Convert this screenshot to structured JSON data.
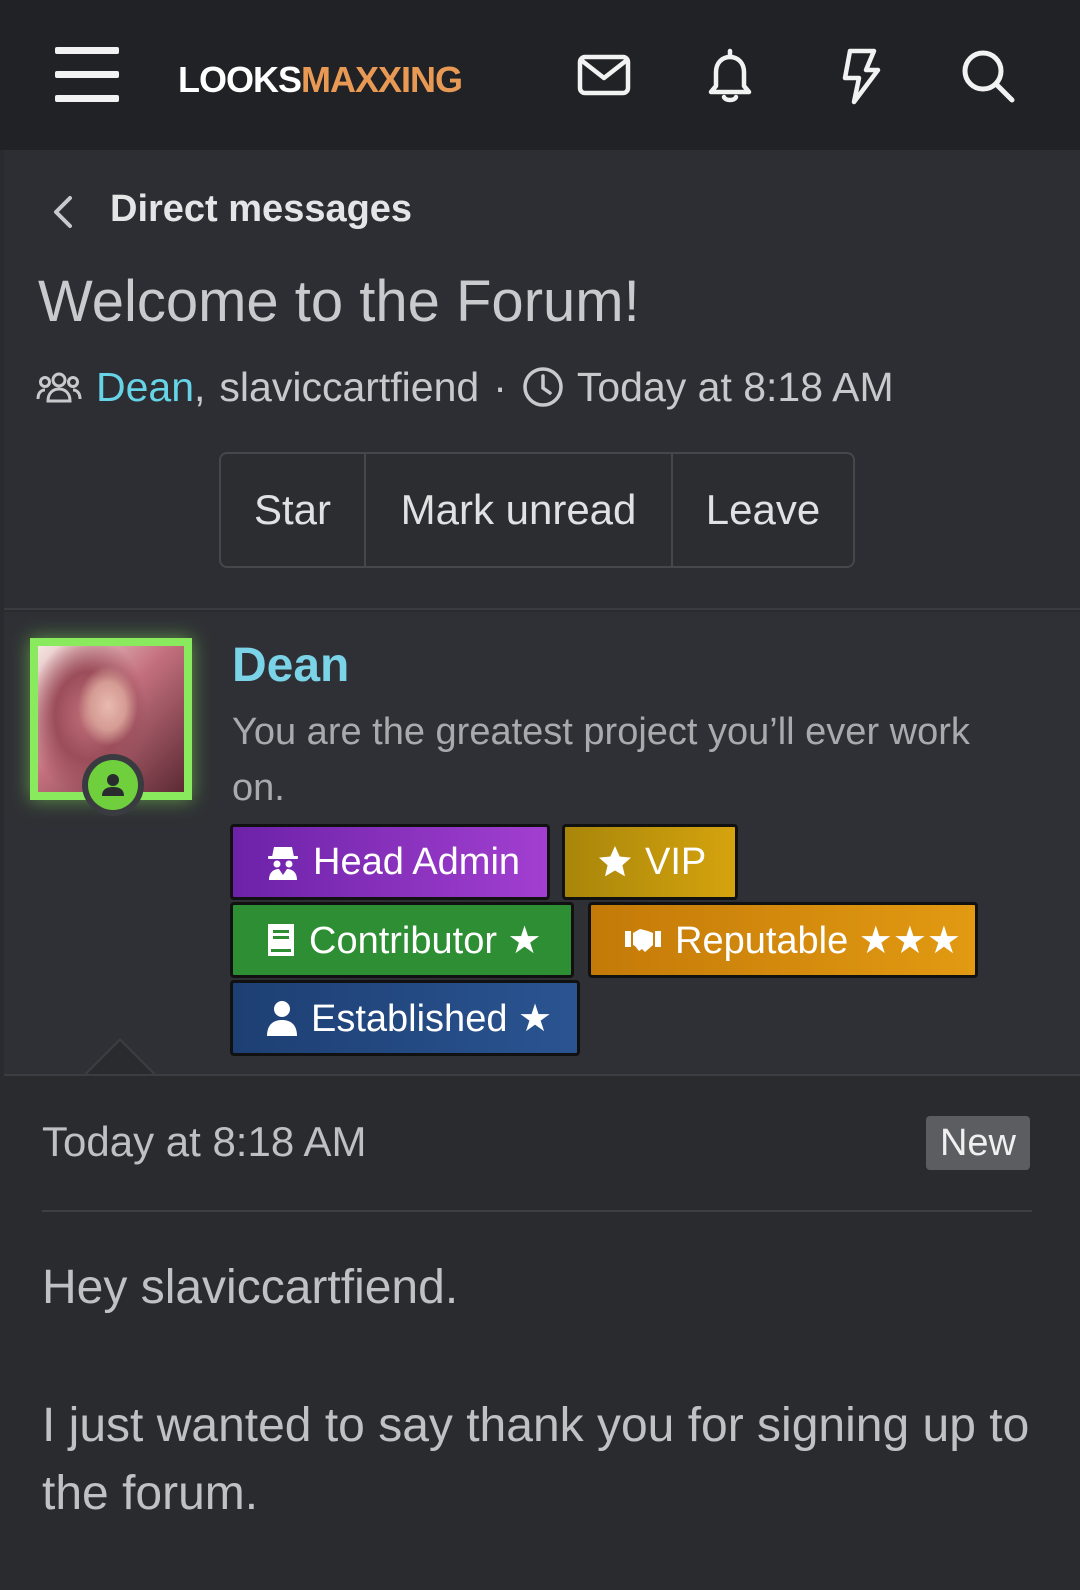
{
  "header": {
    "logo_part1": "LOOKS",
    "logo_part2": "MAXXING",
    "icons": [
      "menu-icon",
      "mail-icon",
      "bell-icon",
      "lightning-icon",
      "search-icon"
    ]
  },
  "conversation": {
    "breadcrumb": "Direct messages",
    "title": "Welcome to the Forum!",
    "participant1": "Dean",
    "participant_sep": ",",
    "participant2": "slaviccartfiend",
    "separator": "·",
    "time": "Today at 8:18 AM",
    "actions": {
      "star": "Star",
      "mark_unread": "Mark unread",
      "leave": "Leave"
    }
  },
  "message": {
    "author": "Dean",
    "user_title": "You are the greatest project you’ll ever work on.",
    "banners": {
      "head_admin": "Head Admin",
      "vip": "VIP",
      "contributor": "Contributor ★",
      "reputable": "Reputable ★★★",
      "established": "Established ★"
    },
    "date": "Today at 8:18 AM",
    "new_label": "New",
    "paragraph1": "Hey slaviccartfiend.",
    "paragraph2": "I just wanted to say thank you for signing up to the forum."
  },
  "colors": {
    "accent_orange": "#e89a55",
    "username_cyan": "#7bd3e8",
    "online_green": "#88ea5c"
  }
}
